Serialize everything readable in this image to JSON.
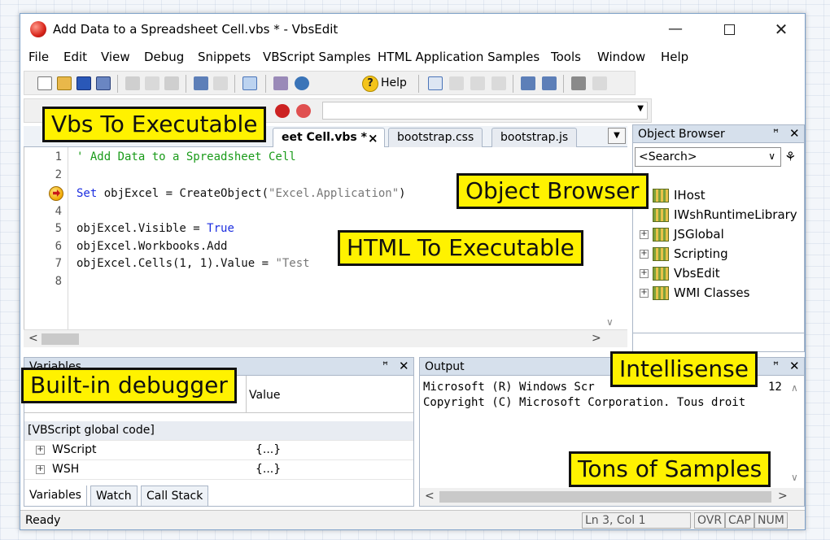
{
  "window": {
    "title": "Add Data to a Spreadsheet Cell.vbs * - VbsEdit",
    "minimize_glyph": "—",
    "close_glyph": "✕"
  },
  "menu": [
    "File",
    "Edit",
    "View",
    "Debug",
    "Snippets",
    "VBScript Samples",
    "HTML Application Samples",
    "Tools",
    "Window",
    "Help"
  ],
  "toolbar": {
    "help_label": "Help",
    "help_glyph": "?"
  },
  "tabs": {
    "active": "eet Cell.vbs *",
    "active_close": "×",
    "items": [
      "bootstrap.css",
      "bootstrap.js"
    ],
    "dropdown_glyph": "▼"
  },
  "editor": {
    "line_numbers": [
      "1",
      "2",
      "4",
      "5",
      "6",
      "7",
      "8"
    ],
    "lines": {
      "l1_comment": "' Add Data to a Spreadsheet Cell",
      "l3_kw": "Set",
      "l3_plain": " objExcel = CreateObject(",
      "l3_str": "\"Excel.Application\"",
      "l3_close": ")",
      "l5_plain": "objExcel.Visible = ",
      "l5_kw": "True",
      "l6_plain": "objExcel.Workbooks.Add",
      "l7_plain": "objExcel.Cells(1, 1).Value = ",
      "l7_str": "\"Test"
    },
    "hscroll_left": "<",
    "hscroll_right": ">",
    "vscroll_down": "∨"
  },
  "object_browser": {
    "title": "Object Browser",
    "search_placeholder": "<Search>",
    "search_arrow": "∨",
    "find_glyph": "⚘",
    "items": [
      "IHost",
      "IWshRuntimeLibrary",
      "JSGlobal",
      "Scripting",
      "VbsEdit",
      "WMI Classes"
    ],
    "expander_glyph": "+",
    "pin_glyph": "ꟸ",
    "close_glyph": "✕"
  },
  "variables": {
    "title": "Variables",
    "value_header": "Value",
    "group": "[VBScript global code]",
    "rows": [
      {
        "name": "WScript",
        "value": "{...}"
      },
      {
        "name": "WSH",
        "value": "{...}"
      }
    ],
    "tabs": [
      "Variables",
      "Watch",
      "Call Stack"
    ]
  },
  "output": {
    "title": "Output",
    "lines": [
      "Microsoft (R) Windows Scr",
      "Copyright (C) Microsoft Corporation. Tous droit"
    ],
    "partial_right": "12",
    "scroll_up": "∧",
    "scroll_down": "∨",
    "hscroll_left": "<",
    "hscroll_right": ">"
  },
  "status": {
    "ready": "Ready",
    "position": "Ln 3, Col 1",
    "ovr": "OVR",
    "cap": "CAP",
    "num": "NUM"
  },
  "callouts": {
    "vbs": "Vbs To Executable",
    "object_browser": "Object Browser",
    "html": "HTML To Executable",
    "intellisense": "Intellisense",
    "debugger": "Built-in debugger",
    "samples": "Tons of Samples"
  }
}
